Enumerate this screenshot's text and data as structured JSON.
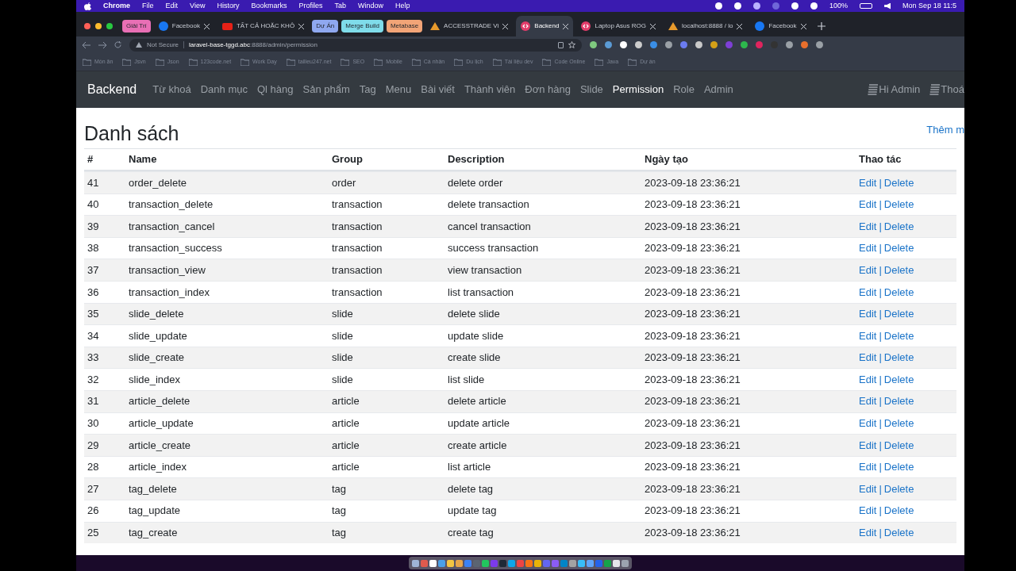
{
  "menu_bar": {
    "app": "Chrome",
    "items": [
      "File",
      "Edit",
      "View",
      "History",
      "Bookmarks",
      "Profiles",
      "Tab",
      "Window",
      "Help"
    ],
    "battery": "100%",
    "clock": "Mon Sep 18 11:5"
  },
  "tabs": [
    {
      "kind": "group",
      "label": "Giải Trí",
      "color": "#e86fb5"
    },
    {
      "kind": "tab",
      "label": "Facebook",
      "selected": false
    },
    {
      "kind": "tab",
      "label": "TẤT CẢ HOẶC KHÔ",
      "selected": false
    },
    {
      "kind": "group",
      "label": "Dự Án",
      "color": "#8fa8f0"
    },
    {
      "kind": "group",
      "label": "Merge Build",
      "color": "#7fdcea"
    },
    {
      "kind": "group",
      "label": "Metabase",
      "color": "#f2a477"
    },
    {
      "kind": "tab",
      "label": "ACCESSTRADE Vi",
      "selected": false
    },
    {
      "kind": "tab",
      "label": "Backend",
      "selected": true
    },
    {
      "kind": "tab",
      "label": "Laptop Asus ROG",
      "selected": false
    },
    {
      "kind": "tab",
      "label": "localhost:8888 / lo",
      "selected": false
    },
    {
      "kind": "tab",
      "label": "Facebook",
      "selected": false
    }
  ],
  "address_bar": {
    "security": "Not Secure",
    "host": "laravel-base-tggd.abc",
    "path": ":8888/admin/permission"
  },
  "bookmarks": [
    "Món ăn",
    "Jsvn",
    "Json",
    "123code.net",
    "Work Day",
    "tailieu247.net",
    "SEO",
    "Mobile",
    "Cá nhân",
    "Du lịch",
    "Tài liệu dev",
    "Code Online",
    "Java",
    "Dự án"
  ],
  "navbar": {
    "brand": "Backend",
    "items": [
      {
        "label": "Từ khoá",
        "selected": false
      },
      {
        "label": "Danh mục",
        "selected": false
      },
      {
        "label": "Ql hàng",
        "selected": false
      },
      {
        "label": "Sản phẩm",
        "selected": false
      },
      {
        "label": "Tag",
        "selected": false
      },
      {
        "label": "Menu",
        "selected": false
      },
      {
        "label": "Bài viết",
        "selected": false
      },
      {
        "label": "Thành viên",
        "selected": false
      },
      {
        "label": "Đơn hàng",
        "selected": false
      },
      {
        "label": "Slide",
        "selected": false
      },
      {
        "label": "Permission",
        "selected": true
      },
      {
        "label": "Role",
        "selected": false
      },
      {
        "label": "Admin",
        "selected": false
      }
    ],
    "right": [
      "Hi Admin",
      "Thoá"
    ]
  },
  "page": {
    "title": "Danh sách",
    "add_link": "Thêm m"
  },
  "table": {
    "columns": [
      "#",
      "Name",
      "Group",
      "Description",
      "Ngày tạo",
      "Thao tác"
    ],
    "rows": [
      [
        "41",
        "order_delete",
        "order",
        "delete order",
        "2023-09-18 23:36:21"
      ],
      [
        "40",
        "transaction_delete",
        "transaction",
        "delete transaction",
        "2023-09-18 23:36:21"
      ],
      [
        "39",
        "transaction_cancel",
        "transaction",
        "cancel transaction",
        "2023-09-18 23:36:21"
      ],
      [
        "38",
        "transaction_success",
        "transaction",
        "success transaction",
        "2023-09-18 23:36:21"
      ],
      [
        "37",
        "transaction_view",
        "transaction",
        "view transaction",
        "2023-09-18 23:36:21"
      ],
      [
        "36",
        "transaction_index",
        "transaction",
        "list transaction",
        "2023-09-18 23:36:21"
      ],
      [
        "35",
        "slide_delete",
        "slide",
        "delete slide",
        "2023-09-18 23:36:21"
      ],
      [
        "34",
        "slide_update",
        "slide",
        "update slide",
        "2023-09-18 23:36:21"
      ],
      [
        "33",
        "slide_create",
        "slide",
        "create slide",
        "2023-09-18 23:36:21"
      ],
      [
        "32",
        "slide_index",
        "slide",
        "list slide",
        "2023-09-18 23:36:21"
      ],
      [
        "31",
        "article_delete",
        "article",
        "delete article",
        "2023-09-18 23:36:21"
      ],
      [
        "30",
        "article_update",
        "article",
        "update article",
        "2023-09-18 23:36:21"
      ],
      [
        "29",
        "article_create",
        "article",
        "create article",
        "2023-09-18 23:36:21"
      ],
      [
        "28",
        "article_index",
        "article",
        "list article",
        "2023-09-18 23:36:21"
      ],
      [
        "27",
        "tag_delete",
        "tag",
        "delete tag",
        "2023-09-18 23:36:21"
      ],
      [
        "26",
        "tag_update",
        "tag",
        "update tag",
        "2023-09-18 23:36:21"
      ],
      [
        "25",
        "tag_create",
        "tag",
        "create tag",
        "2023-09-18 23:36:21"
      ]
    ],
    "actions": [
      [
        "Edit",
        "|",
        "Delete"
      ],
      [
        "Edit",
        "|",
        "Delete"
      ],
      [
        "Edit",
        "|",
        "Delete"
      ],
      [
        "Edit",
        "|",
        "Delete"
      ],
      [
        "Edit",
        "|",
        "Delete"
      ],
      [
        "Edit",
        "|",
        "Delete"
      ],
      [
        "Edit",
        "|",
        "Delete"
      ],
      [
        "Edit",
        "|",
        "Delete"
      ],
      [
        "Edit",
        "|",
        "Delete"
      ],
      [
        "Edit",
        "|",
        "Delete"
      ],
      [
        "Edit",
        "|",
        "Delete"
      ],
      [
        "Edit",
        "|",
        "Delete"
      ],
      [
        "Edit",
        "|",
        "Delete"
      ],
      [
        "Edit",
        "|",
        "Delete"
      ],
      [
        "Edit",
        "|",
        "Delete"
      ],
      [
        "Edit",
        "|",
        "Delete"
      ],
      [
        "Edit",
        "|",
        "Delete"
      ]
    ]
  }
}
